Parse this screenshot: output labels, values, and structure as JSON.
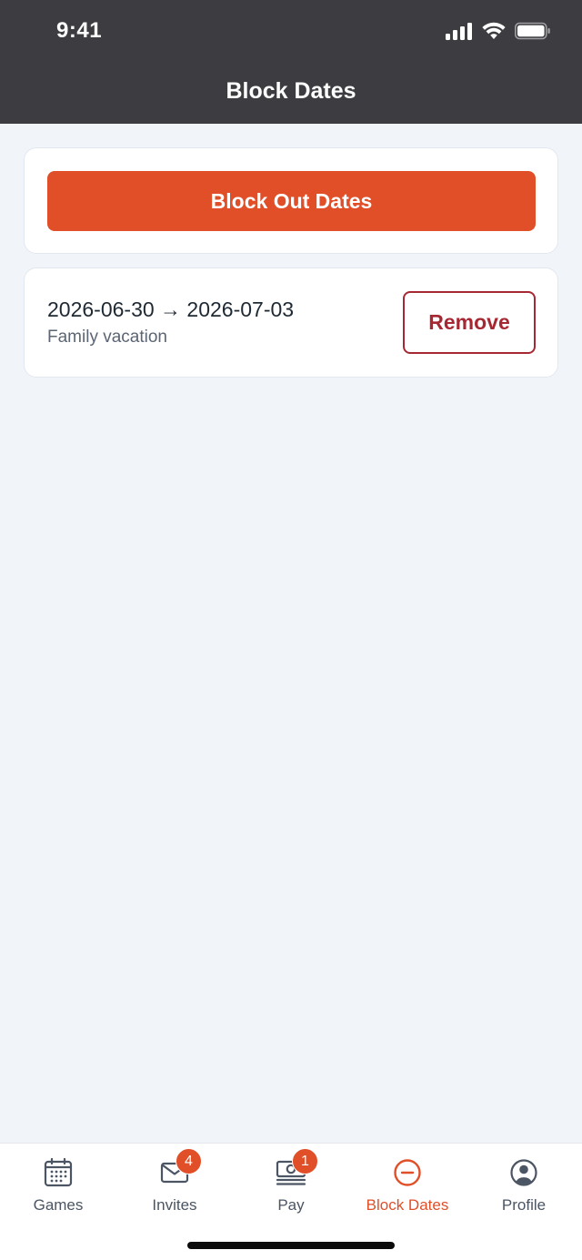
{
  "status_bar": {
    "time": "9:41",
    "icons": [
      "signal-icon",
      "wifi-icon",
      "battery-icon"
    ]
  },
  "header": {
    "title": "Block Dates"
  },
  "actions": {
    "block_out_label": "Block Out Dates"
  },
  "blocked_entries": [
    {
      "range": "2026-06-30 → 2026-07-03",
      "note": "Family vacation",
      "remove_label": "Remove"
    }
  ],
  "tabs": [
    {
      "label": "Games",
      "icon": "calendar-icon",
      "badge": null,
      "active": false
    },
    {
      "label": "Invites",
      "icon": "envelope-icon",
      "badge": "4",
      "active": false
    },
    {
      "label": "Pay",
      "icon": "money-icon",
      "badge": "1",
      "active": false
    },
    {
      "label": "Block Dates",
      "icon": "minus-circle-icon",
      "badge": null,
      "active": true
    },
    {
      "label": "Profile",
      "icon": "user-circle-icon",
      "badge": null,
      "active": false
    }
  ],
  "colors": {
    "header_bg": "#3d3c41",
    "accent": "#e04f28",
    "danger": "#a62833",
    "page_bg": "#f1f5f9"
  }
}
